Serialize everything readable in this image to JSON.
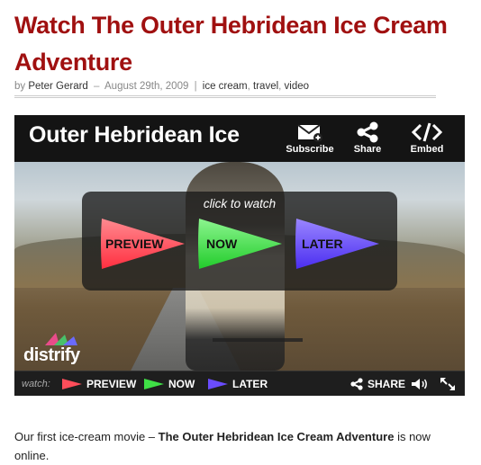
{
  "post": {
    "title": "Watch The Outer Hebridean Ice Cream Adventure",
    "meta": {
      "by": "by",
      "author": "Peter Gerard",
      "date_sep": "–",
      "date": "August 29th, 2009",
      "pipe": "|",
      "tags": [
        "ice cream",
        "travel",
        "video"
      ]
    }
  },
  "player": {
    "title": "Outer Hebridean Ice",
    "actions": [
      {
        "label": "Subscribe",
        "icon": "envelope-plus-icon"
      },
      {
        "label": "Share",
        "icon": "share-icon"
      },
      {
        "label": "Embed",
        "icon": "code-embed-icon"
      }
    ],
    "overlay": {
      "prompt": "click to watch",
      "buttons": [
        {
          "label": "PREVIEW",
          "color": "#ff4d5a"
        },
        {
          "label": "NOW",
          "color": "#3fe046"
        },
        {
          "label": "LATER",
          "color": "#6a4cff"
        }
      ]
    },
    "logo": "distrify",
    "bottombar": {
      "watch_label": "watch:",
      "items": [
        {
          "label": "PREVIEW",
          "color": "#ff4d5a"
        },
        {
          "label": "NOW",
          "color": "#3fe046"
        },
        {
          "label": "LATER",
          "color": "#6a4cff"
        }
      ],
      "share": "SHARE",
      "volume_icon": "speaker-icon",
      "fullscreen_icon": "fullscreen-arrows-icon"
    }
  },
  "body": {
    "intro": "Our first ice-cream movie –",
    "bold": "The Outer Hebridean Ice Cream Adventure",
    "outro": "is now online."
  }
}
